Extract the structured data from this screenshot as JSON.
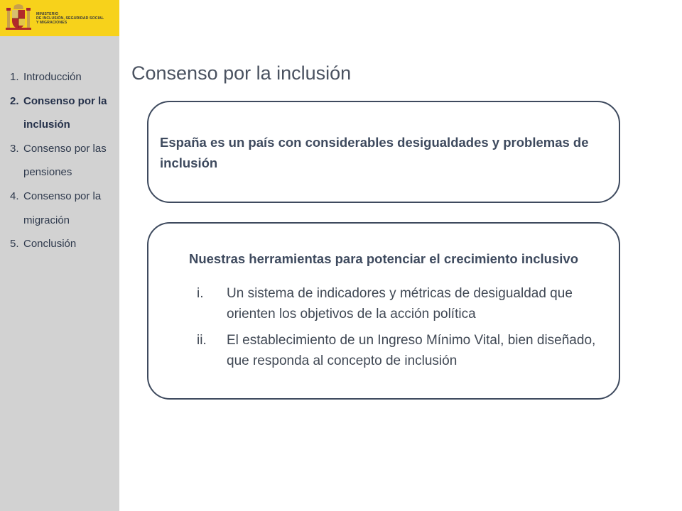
{
  "header": {
    "ministry_lines": [
      "MINISTERIO",
      "DE INCLUSIÓN, SEGURIDAD SOCIAL",
      "Y MIGRACIONES"
    ],
    "brand_color": "#f7d21b",
    "crest_icon": "coat-of-arms-icon"
  },
  "sidebar": {
    "items": [
      {
        "number": "1.",
        "label": "Introducción",
        "active": false
      },
      {
        "number": "2.",
        "label": "Consenso por la inclusión",
        "active": true
      },
      {
        "number": "3.",
        "label": "Consenso por las pensiones",
        "active": false
      },
      {
        "number": "4.",
        "label": "Consenso por la migración",
        "active": false
      },
      {
        "number": "5.",
        "label": "Conclusión",
        "active": false
      }
    ]
  },
  "slide": {
    "title": "Consenso por la inclusión",
    "box1_text": "España es un país con considerables desigualdades y problemas de inclusión",
    "box2_heading": "Nuestras herramientas para potenciar el crecimiento inclusivo",
    "tools": [
      {
        "marker": "i.",
        "text": "Un sistema de indicadores y métricas de desigualdad que orienten los objetivos de la acción política"
      },
      {
        "marker": "ii.",
        "text": "El establecimiento de un Ingreso Mínimo Vital, bien diseñado, que responda al concepto de inclusión"
      }
    ]
  }
}
